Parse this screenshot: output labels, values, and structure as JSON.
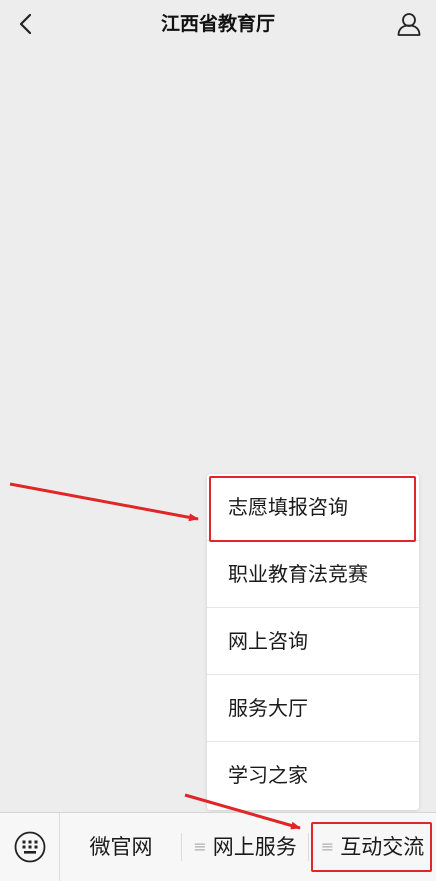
{
  "header": {
    "title": "江西省教育厅",
    "back_icon": "chevron-left-icon",
    "profile_icon": "user-icon"
  },
  "submenu": {
    "items": [
      {
        "label": "志愿填报咨询",
        "highlighted": true
      },
      {
        "label": "职业教育法竞赛"
      },
      {
        "label": "网上咨询"
      },
      {
        "label": "服务大厅"
      },
      {
        "label": "学习之家"
      }
    ]
  },
  "menu_bar": {
    "keyboard_icon": "keyboard-icon",
    "menu_glyph": "≡",
    "items": [
      {
        "label": "微官网"
      },
      {
        "label": "网上服务"
      },
      {
        "label": "互动交流",
        "highlighted": true
      }
    ]
  },
  "colors": {
    "background": "#ededed",
    "annotation_red": "#e02626",
    "menu_bar": "#f7f7f7"
  }
}
